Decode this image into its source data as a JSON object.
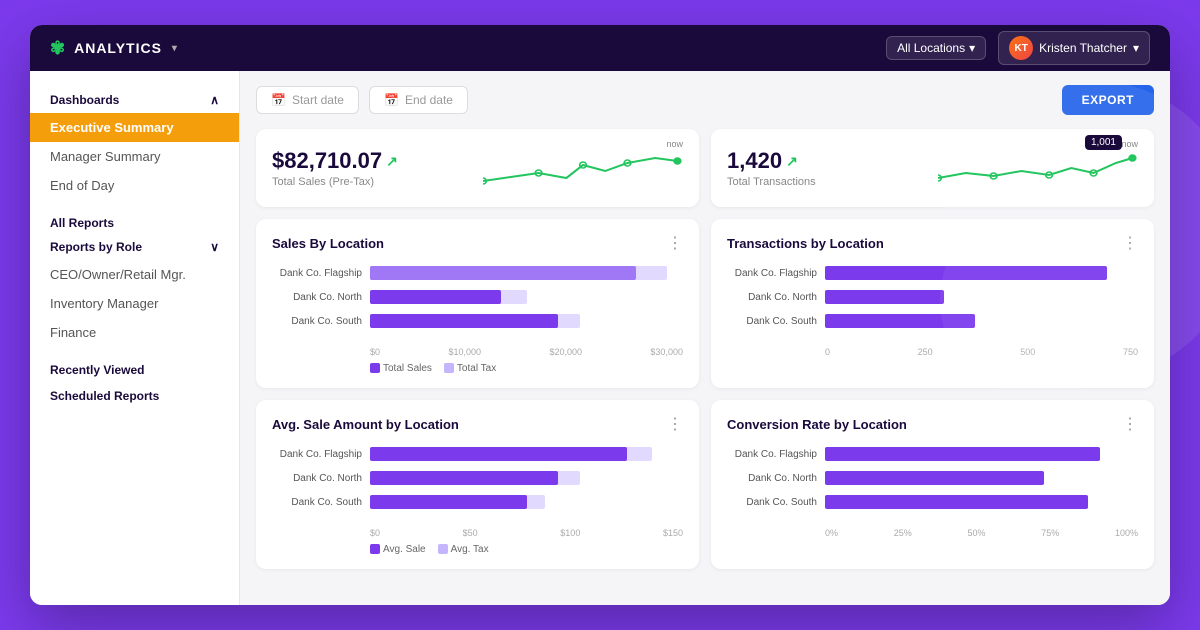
{
  "nav": {
    "brand": "ANALYTICS",
    "leaf": "✿",
    "location": "All Locations",
    "user": "Kristen Thatcher",
    "user_initials": "KT"
  },
  "toolbar": {
    "start_placeholder": "Start date",
    "end_placeholder": "End date",
    "export_label": "EXPORT"
  },
  "sidebar": {
    "dashboards_label": "Dashboards",
    "items": [
      {
        "label": "Executive Summary",
        "active": true
      },
      {
        "label": "Manager Summary",
        "active": false
      },
      {
        "label": "End of Day",
        "active": false
      }
    ],
    "all_reports_label": "All Reports",
    "reports_by_role_label": "Reports by Role",
    "reports_by_role_items": [
      {
        "label": "CEO/Owner/Retail Mgr."
      },
      {
        "label": "Inventory Manager"
      },
      {
        "label": "Finance"
      }
    ],
    "recently_viewed_label": "Recently Viewed",
    "scheduled_reports_label": "Scheduled Reports"
  },
  "stats": [
    {
      "value": "$82,710.07",
      "label": "Total Sales (Pre-Tax)",
      "tooltip": null
    },
    {
      "value": "1,420",
      "label": "Total Transactions",
      "tooltip": "1,001"
    }
  ],
  "charts": {
    "row1": [
      {
        "title": "Sales By Location",
        "bars": [
          {
            "label": "Dank Co. Flagship",
            "main": 85,
            "secondary": 10
          },
          {
            "label": "Dank Co. North",
            "main": 42,
            "secondary": 8
          },
          {
            "label": "Dank Co. South",
            "main": 60,
            "secondary": 7
          }
        ],
        "axis": [
          "$0",
          "$10,000",
          "$20,000",
          "$30,000"
        ],
        "legend": [
          "Total Sales",
          "Total Tax"
        ]
      },
      {
        "title": "Transactions by Location",
        "bars": [
          {
            "label": "Dank Co. Flagship",
            "main": 90,
            "secondary": 0
          },
          {
            "label": "Dank Co. North",
            "main": 38,
            "secondary": 0
          },
          {
            "label": "Dank Co. South",
            "main": 48,
            "secondary": 0
          }
        ],
        "axis": [
          "0",
          "250",
          "500",
          "750"
        ],
        "legend": []
      }
    ],
    "row2": [
      {
        "title": "Avg. Sale Amount by Location",
        "bars": [
          {
            "label": "Dank Co. Flagship",
            "main": 82,
            "secondary": 8
          },
          {
            "label": "Dank Co. North",
            "main": 60,
            "secondary": 7
          },
          {
            "label": "Dank Co. South",
            "main": 50,
            "secondary": 6
          }
        ],
        "axis": [
          "$0",
          "$50",
          "$100",
          "$150"
        ],
        "legend": [
          "Avg. Sale",
          "Avg. Tax"
        ]
      },
      {
        "title": "Conversion Rate by Location",
        "bars": [
          {
            "label": "Dank Co. Flagship",
            "main": 88,
            "secondary": 0
          },
          {
            "label": "Dank Co. North",
            "main": 70,
            "secondary": 0
          },
          {
            "label": "Dank Co. South",
            "main": 84,
            "secondary": 0
          }
        ],
        "axis": [
          "0%",
          "25%",
          "50%",
          "75%",
          "100%"
        ],
        "legend": []
      }
    ]
  },
  "colors": {
    "purple": "#7c3aed",
    "light_purple": "#c4b5fd",
    "green": "#22c55e",
    "blue": "#2563eb",
    "dark": "#1a0a3c"
  }
}
